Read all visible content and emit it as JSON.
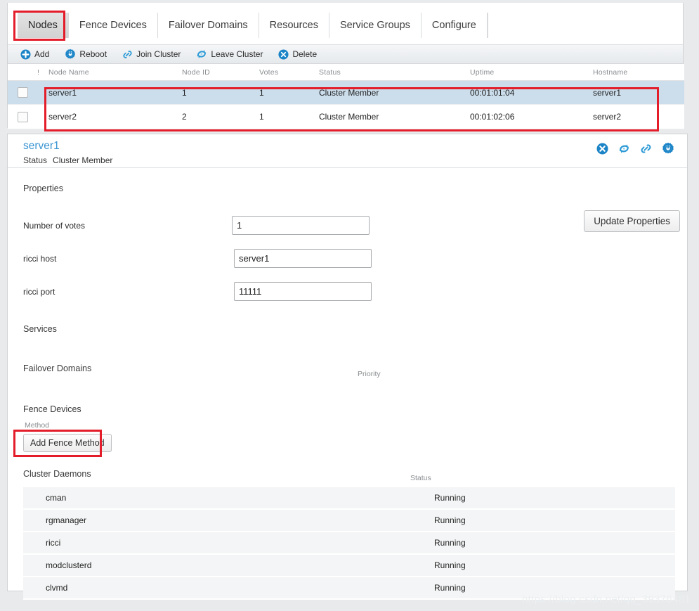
{
  "tabs": [
    {
      "label": "Nodes",
      "active": true
    },
    {
      "label": "Fence Devices",
      "active": false
    },
    {
      "label": "Failover Domains",
      "active": false
    },
    {
      "label": "Resources",
      "active": false
    },
    {
      "label": "Service Groups",
      "active": false
    },
    {
      "label": "Configure",
      "active": false
    }
  ],
  "toolbar": [
    {
      "label": "Add",
      "icon": "plus-circle-icon"
    },
    {
      "label": "Reboot",
      "icon": "reboot-gear-icon"
    },
    {
      "label": "Join Cluster",
      "icon": "link-icon"
    },
    {
      "label": "Leave Cluster",
      "icon": "leave-cluster-icon"
    },
    {
      "label": "Delete",
      "icon": "x-circle-icon"
    }
  ],
  "nodes_table": {
    "headers": [
      "",
      "!",
      "Node Name",
      "Node ID",
      "Votes",
      "Status",
      "Uptime",
      "Hostname"
    ],
    "rows": [
      {
        "name": "server1",
        "id": "1",
        "votes": "1",
        "status": "Cluster Member",
        "uptime": "00:01:01:04",
        "hostname": "server1",
        "selected": true
      },
      {
        "name": "server2",
        "id": "2",
        "votes": "1",
        "status": "Cluster Member",
        "uptime": "00:01:02:06",
        "hostname": "server2",
        "selected": false
      }
    ]
  },
  "detail": {
    "title": "server1",
    "status_label": "Status",
    "status_value": "Cluster Member",
    "actions": [
      {
        "name": "delete-icon"
      },
      {
        "name": "leave-cluster-icon"
      },
      {
        "name": "join-cluster-icon"
      },
      {
        "name": "reboot-icon"
      }
    ],
    "properties_title": "Properties",
    "update_button": "Update Properties",
    "fields": [
      {
        "label": "Number of votes",
        "value": "1"
      },
      {
        "label": "ricci host",
        "value": "server1"
      },
      {
        "label": "ricci port",
        "value": "11111"
      }
    ],
    "services_title": "Services",
    "failover_title": "Failover Domains",
    "priority_header": "Priority",
    "fence_title": "Fence Devices",
    "method_header": "Method",
    "add_fence_button": "Add Fence Method",
    "daemons_title": "Cluster Daemons",
    "daemons_status_header": "Status",
    "daemons": [
      {
        "name": "cman",
        "status": "Running"
      },
      {
        "name": "rgmanager",
        "status": "Running"
      },
      {
        "name": "ricci",
        "status": "Running"
      },
      {
        "name": "modclusterd",
        "status": "Running"
      },
      {
        "name": "clvmd",
        "status": "Running"
      }
    ]
  },
  "watermark": "https://blog.csdn.net/qq_39376481",
  "colors": {
    "accent": "#3b95d3",
    "selected_row": "#ccdeec",
    "annotation": "#e31d2a",
    "page_bg": "#e8eaec"
  }
}
